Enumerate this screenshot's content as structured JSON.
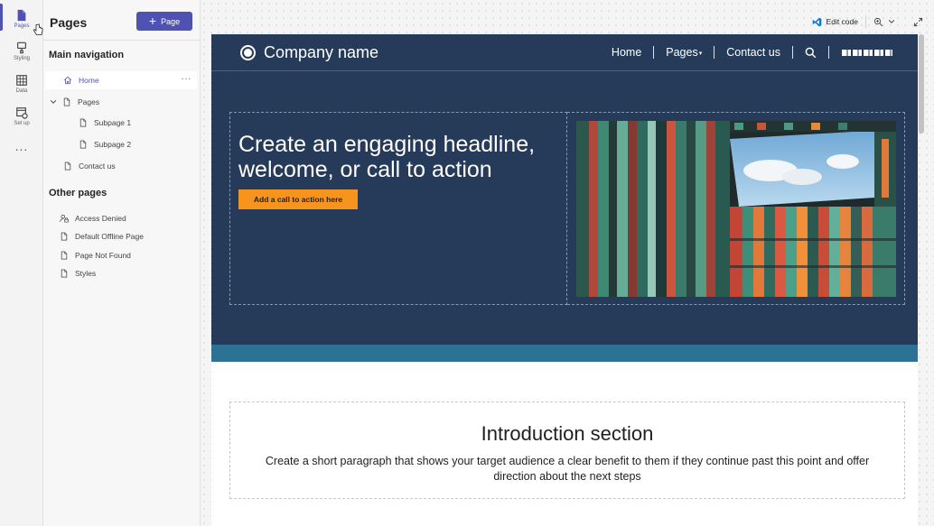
{
  "rail": {
    "items": [
      {
        "label": "Pages",
        "icon": "page-icon"
      },
      {
        "label": "Styling",
        "icon": "paintbrush-icon"
      },
      {
        "label": "Data",
        "icon": "table-icon"
      },
      {
        "label": "Set up",
        "icon": "setup-icon"
      }
    ],
    "more": "..."
  },
  "panel": {
    "title": "Pages",
    "add_button": "Page",
    "main_nav_heading": "Main navigation",
    "main_nav": [
      {
        "label": "Home",
        "icon": "home-icon"
      },
      {
        "label": "Pages",
        "icon": "page-icon"
      },
      {
        "label": "Subpage 1",
        "icon": "page-icon"
      },
      {
        "label": "Subpage 2",
        "icon": "page-icon"
      },
      {
        "label": "Contact us",
        "icon": "page-icon"
      }
    ],
    "more_dots": "···",
    "other_heading": "Other pages",
    "other_pages": [
      {
        "label": "Access Denied",
        "icon": "user-lock-icon"
      },
      {
        "label": "Default Offline Page",
        "icon": "page-icon"
      },
      {
        "label": "Page Not Found",
        "icon": "page-icon"
      },
      {
        "label": "Styles",
        "icon": "page-icon"
      }
    ]
  },
  "toolbar": {
    "edit_code": "Edit code"
  },
  "site": {
    "company": "Company name",
    "menu": {
      "home": "Home",
      "pages": "Pages",
      "contact": "Contact us"
    },
    "hero": {
      "headline": "Create an engaging headline, welcome, or call to action",
      "cta": "Add a call to action here"
    },
    "intro": {
      "title": "Introduction section",
      "text": "Create a short paragraph that shows your target audience a clear benefit to them if they continue past this point and offer direction about the next steps"
    }
  },
  "colors": {
    "accent": "#4f52b2",
    "site_header": "#263a5a",
    "cta": "#f7941d",
    "band": "#2b7294"
  }
}
